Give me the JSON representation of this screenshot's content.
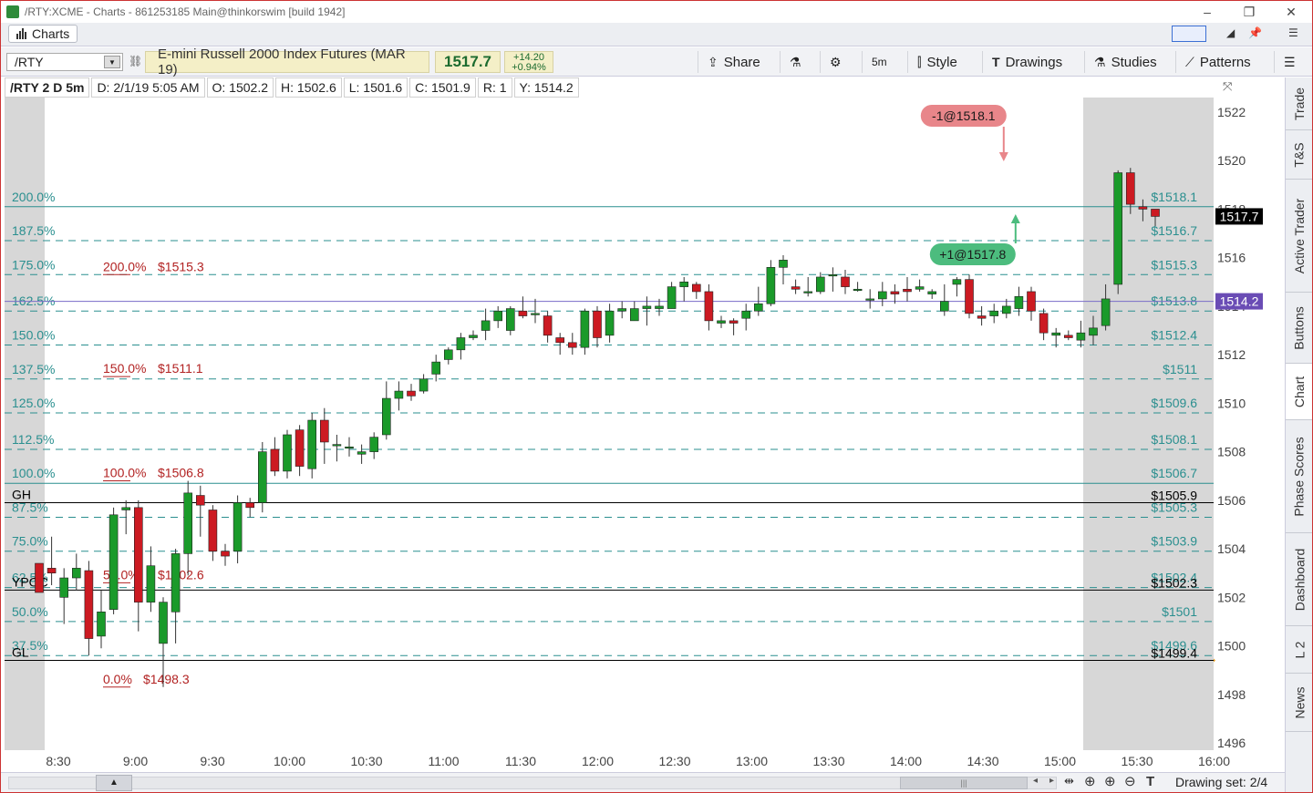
{
  "window": {
    "title": "/RTY:XCME - Charts - 861253185 Main@thinkorswim [build 1942]",
    "controls": [
      "–",
      "❐",
      "✕"
    ]
  },
  "tabbar": {
    "charts_tab": "Charts"
  },
  "toolbar": {
    "symbol": "/RTY",
    "description": "E-mini Russell 2000 Index Futures (MAR 19)",
    "last": "1517.7",
    "change": "+14.20",
    "change_pct": "+0.94%",
    "buttons": {
      "share": "Share",
      "timeframe": "5m",
      "style": "Style",
      "drawings": "Drawings",
      "studies": "Studies",
      "patterns": "Patterns"
    }
  },
  "infobar": {
    "chart_id": "/RTY 2 D 5m",
    "date": "D: 2/1/19 5:05 AM",
    "open": "O: 1502.2",
    "high": "H: 1502.6",
    "low": "L: 1501.6",
    "close": "C: 1501.9",
    "range": "R: 1",
    "y": "Y: 1514.2"
  },
  "sidebar": {
    "tabs": [
      "Trade",
      "T&S",
      "Active Trader",
      "Buttons",
      "Chart",
      "Phase Scores",
      "Dashboard",
      "L 2",
      "News"
    ],
    "active": "Chart"
  },
  "bottombar": {
    "drawing_set": "Drawing set: 2/4"
  },
  "colors": {
    "up": "#1a9a2a",
    "down": "#cc1a22",
    "fib": "#2a8f8f",
    "fib_label": "#b22222",
    "current_price_bg": "#000000",
    "marker_price_bg": "#6a4cb5",
    "sell_bubble": "#e8868a",
    "buy_bubble": "#4cbc7e"
  },
  "chart_data": {
    "type": "candlestick",
    "ylim": [
      1495.7,
      1522.6
    ],
    "x_ticks": [
      "8:30",
      "9:00",
      "9:30",
      "10:00",
      "10:30",
      "11:00",
      "11:30",
      "12:00",
      "12:30",
      "13:00",
      "13:30",
      "14:00",
      "14:30",
      "15:00",
      "15:30",
      "16:00"
    ],
    "y_ticks": [
      1522,
      1520,
      1518,
      1516,
      1514,
      1512,
      1510,
      1508,
      1506,
      1504,
      1502,
      1500,
      1498,
      1496
    ],
    "current_price": "1517.7",
    "marker_price": "1514.2",
    "fib_right": [
      {
        "pct": "200.0%",
        "price": 1518.1,
        "label": "$1518.1",
        "solid": true
      },
      {
        "pct": "187.5%",
        "price": 1516.7,
        "label": "$1516.7"
      },
      {
        "pct": "175.0%",
        "price": 1515.3,
        "label": "$1515.3"
      },
      {
        "pct": "162.5%",
        "price": 1513.8,
        "label": "$1513.8"
      },
      {
        "pct": "150.0%",
        "price": 1512.4,
        "label": "$1512.4"
      },
      {
        "pct": "137.5%",
        "price": 1511.0,
        "label": "$1511"
      },
      {
        "pct": "125.0%",
        "price": 1509.6,
        "label": "$1509.6"
      },
      {
        "pct": "112.5%",
        "price": 1508.1,
        "label": "$1508.1"
      },
      {
        "pct": "100.0%",
        "price": 1506.7,
        "label": "$1506.7",
        "solid": true
      },
      {
        "pct": "87.5%",
        "price": 1505.3,
        "label": "$1505.3"
      },
      {
        "pct": "75.0%",
        "price": 1503.9,
        "label": "$1503.9"
      },
      {
        "pct": "62.5%",
        "price": 1502.4,
        "label": "$1502.4"
      },
      {
        "pct": "50.0%",
        "price": 1501.0,
        "label": "$1501"
      },
      {
        "pct": "37.5%",
        "price": 1499.6,
        "label": "$1499.6"
      }
    ],
    "fib_left": [
      {
        "pct": "200.0%",
        "price": 1515.3,
        "label": "$1515.3"
      },
      {
        "pct": "150.0%",
        "price": 1511.1,
        "label": "$1511.1"
      },
      {
        "pct": "100.0%",
        "price": 1506.8,
        "label": "$1506.8"
      },
      {
        "pct": "50.0%",
        "price": 1502.6,
        "label": "$1502.6"
      },
      {
        "pct": "0.0%",
        "price": 1498.3,
        "label": "$1498.3"
      }
    ],
    "levels": [
      {
        "name": "GH",
        "price": 1505.9,
        "label": "$1505.9"
      },
      {
        "name": "YPOC",
        "price": 1502.3,
        "label": "$1502.3"
      },
      {
        "name": "GL",
        "price": 1499.4,
        "label": "$1499.4"
      }
    ],
    "marker_line": 1514.2,
    "trades": [
      {
        "label": "-1@1518.1",
        "side": "sell",
        "price": 1518.1,
        "bar": 78
      },
      {
        "label": "+1@1517.8",
        "side": "buy",
        "price": 1517.8,
        "bar": 78
      }
    ],
    "candles": [
      [
        1503.4,
        1502.2,
        1503.1,
        1502.8
      ],
      [
        1503.2,
        1503.0,
        1504.5,
        1502.5
      ],
      [
        1502.0,
        1502.8,
        1503.2,
        1500.9
      ],
      [
        1502.8,
        1503.2,
        1503.8,
        1502.3
      ],
      [
        1503.1,
        1500.3,
        1503.5,
        1499.6
      ],
      [
        1500.4,
        1501.4,
        1502.3,
        1499.9
      ],
      [
        1501.5,
        1505.4,
        1505.7,
        1501.3
      ],
      [
        1505.6,
        1505.7,
        1506.0,
        1504.6
      ],
      [
        1505.7,
        1501.8,
        1506.0,
        1500.6
      ],
      [
        1501.8,
        1503.3,
        1504.1,
        1501.4
      ],
      [
        1500.1,
        1501.8,
        1502.0,
        1498.3
      ],
      [
        1501.4,
        1503.8,
        1504.0,
        1500.1
      ],
      [
        1503.8,
        1506.3,
        1506.8,
        1502.9
      ],
      [
        1506.2,
        1505.8,
        1506.6,
        1504.5
      ],
      [
        1505.6,
        1503.9,
        1505.8,
        1503.5
      ],
      [
        1503.9,
        1503.7,
        1504.2,
        1503.3
      ],
      [
        1503.9,
        1505.9,
        1506.2,
        1503.4
      ],
      [
        1505.9,
        1505.7,
        1506.1,
        1505.3
      ],
      [
        1505.9,
        1508.0,
        1508.4,
        1505.5
      ],
      [
        1508.1,
        1507.2,
        1508.6,
        1507.0
      ],
      [
        1507.2,
        1508.7,
        1508.9,
        1506.9
      ],
      [
        1508.9,
        1507.4,
        1509.1,
        1507.0
      ],
      [
        1507.3,
        1509.3,
        1509.6,
        1506.9
      ],
      [
        1509.3,
        1508.4,
        1509.8,
        1507.5
      ],
      [
        1508.3,
        1508.3,
        1508.7,
        1507.6
      ],
      [
        1508.2,
        1508.2,
        1508.6,
        1507.8
      ],
      [
        1507.9,
        1508.0,
        1508.3,
        1507.5
      ],
      [
        1508.0,
        1508.6,
        1508.8,
        1507.7
      ],
      [
        1508.7,
        1510.2,
        1510.9,
        1508.5
      ],
      [
        1510.2,
        1510.5,
        1510.9,
        1509.7
      ],
      [
        1510.5,
        1510.3,
        1510.8,
        1510.1
      ],
      [
        1510.5,
        1511.0,
        1511.2,
        1510.4
      ],
      [
        1511.2,
        1511.7,
        1512.0,
        1510.9
      ],
      [
        1511.8,
        1512.2,
        1512.3,
        1511.6
      ],
      [
        1512.2,
        1512.7,
        1512.9,
        1511.8
      ],
      [
        1512.7,
        1512.8,
        1513.0,
        1512.6
      ],
      [
        1513.0,
        1513.4,
        1513.9,
        1512.6
      ],
      [
        1513.4,
        1513.8,
        1514.0,
        1513.1
      ],
      [
        1513.0,
        1513.9,
        1514.0,
        1512.8
      ],
      [
        1513.8,
        1513.6,
        1514.4,
        1513.5
      ],
      [
        1513.7,
        1513.7,
        1514.3,
        1513.3
      ],
      [
        1513.6,
        1512.8,
        1513.8,
        1512.5
      ],
      [
        1512.7,
        1512.5,
        1512.9,
        1512.0
      ],
      [
        1512.5,
        1512.3,
        1512.9,
        1512.0
      ],
      [
        1512.3,
        1513.8,
        1513.9,
        1512.0
      ],
      [
        1513.8,
        1512.7,
        1514.0,
        1512.3
      ],
      [
        1512.8,
        1513.8,
        1514.1,
        1512.5
      ],
      [
        1513.8,
        1513.9,
        1514.2,
        1513.5
      ],
      [
        1513.4,
        1513.9,
        1514.2,
        1513.4
      ],
      [
        1513.9,
        1514.0,
        1514.4,
        1513.2
      ],
      [
        1513.9,
        1514.0,
        1514.3,
        1513.6
      ],
      [
        1513.9,
        1514.8,
        1515.0,
        1513.9
      ],
      [
        1514.8,
        1515.0,
        1515.2,
        1514.2
      ],
      [
        1514.9,
        1514.6,
        1515.0,
        1514.3
      ],
      [
        1514.6,
        1513.4,
        1514.9,
        1513.0
      ],
      [
        1513.3,
        1513.4,
        1513.6,
        1513.1
      ],
      [
        1513.4,
        1513.3,
        1513.5,
        1512.8
      ],
      [
        1513.5,
        1513.8,
        1514.1,
        1513.0
      ],
      [
        1513.8,
        1514.1,
        1514.8,
        1513.6
      ],
      [
        1514.1,
        1515.6,
        1515.9,
        1514.0
      ],
      [
        1515.6,
        1515.9,
        1516.1,
        1514.9
      ],
      [
        1514.8,
        1514.7,
        1515.1,
        1514.5
      ],
      [
        1514.6,
        1514.6,
        1515.2,
        1514.4
      ],
      [
        1514.6,
        1515.2,
        1515.4,
        1514.5
      ],
      [
        1515.3,
        1515.3,
        1515.6,
        1514.6
      ],
      [
        1515.2,
        1514.8,
        1515.5,
        1514.5
      ],
      [
        1514.7,
        1514.7,
        1515.0,
        1514.6
      ],
      [
        1514.3,
        1514.3,
        1514.7,
        1513.9
      ],
      [
        1514.3,
        1514.6,
        1515.0,
        1514.0
      ],
      [
        1514.6,
        1514.5,
        1514.9,
        1514.1
      ],
      [
        1514.7,
        1514.6,
        1515.2,
        1514.2
      ],
      [
        1514.7,
        1514.8,
        1515.1,
        1514.6
      ],
      [
        1514.5,
        1514.6,
        1514.7,
        1514.3
      ],
      [
        1513.8,
        1514.2,
        1514.9,
        1513.6
      ],
      [
        1514.9,
        1515.1,
        1515.2,
        1514.4
      ],
      [
        1515.1,
        1513.7,
        1515.3,
        1513.5
      ],
      [
        1513.6,
        1513.5,
        1514.0,
        1513.2
      ],
      [
        1513.6,
        1513.8,
        1514.1,
        1513.3
      ],
      [
        1513.7,
        1514.0,
        1514.3,
        1513.5
      ],
      [
        1513.9,
        1514.4,
        1514.8,
        1513.6
      ],
      [
        1514.6,
        1513.8,
        1514.8,
        1513.4
      ],
      [
        1513.7,
        1512.9,
        1513.9,
        1512.6
      ],
      [
        1512.8,
        1512.9,
        1513.1,
        1512.3
      ],
      [
        1512.8,
        1512.7,
        1513.0,
        1512.6
      ],
      [
        1512.6,
        1512.9,
        1513.4,
        1512.3
      ],
      [
        1512.8,
        1513.1,
        1513.6,
        1512.4
      ],
      [
        1513.2,
        1514.3,
        1514.9,
        1513.0
      ],
      [
        1514.9,
        1519.5,
        1519.6,
        1514.5
      ],
      [
        1519.5,
        1518.2,
        1519.7,
        1517.8
      ],
      [
        1518.1,
        1518.0,
        1518.4,
        1517.5
      ],
      [
        1518.0,
        1517.7,
        1518.0,
        1517.3
      ]
    ]
  }
}
